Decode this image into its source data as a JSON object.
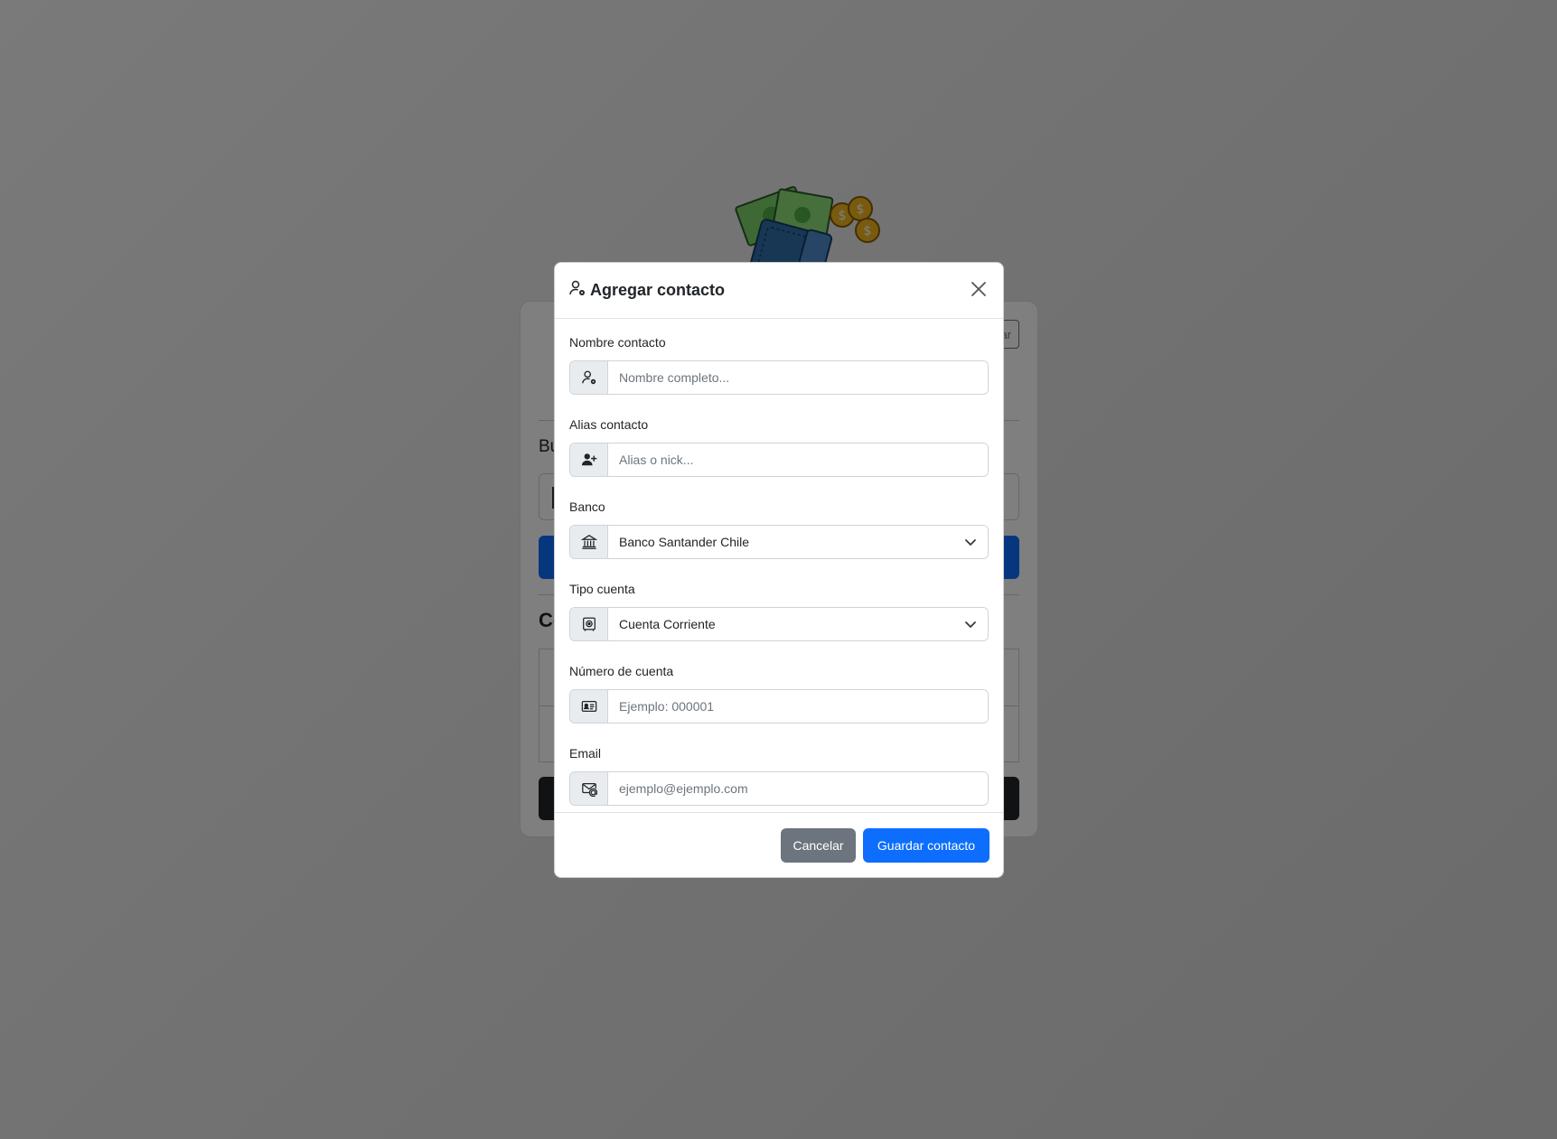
{
  "background": {
    "small_button_label": "ar",
    "search_label_partial": "Bu",
    "section_title_partial": "Co"
  },
  "modal": {
    "title": "Agregar contacto",
    "fields": {
      "nombre": {
        "label": "Nombre contacto",
        "placeholder": "Nombre completo...",
        "value": ""
      },
      "alias": {
        "label": "Alias contacto",
        "placeholder": "Alias o nick...",
        "value": ""
      },
      "banco": {
        "label": "Banco",
        "selected": "Banco Santander Chile"
      },
      "tipo": {
        "label": "Tipo cuenta",
        "selected": "Cuenta Corriente"
      },
      "numero": {
        "label": "Número de cuenta",
        "placeholder": "Ejemplo: 000001",
        "value": ""
      },
      "email": {
        "label": "Email",
        "placeholder": "ejemplo@ejemplo.com",
        "value": ""
      }
    },
    "buttons": {
      "cancel": "Cancelar",
      "save": "Guardar contacto"
    }
  },
  "icons": {
    "title": "person-gear-icon",
    "nombre": "person-gear-icon",
    "alias": "person-plus-icon",
    "banco": "bank-icon",
    "tipo": "safe-icon",
    "numero": "id-card-icon",
    "email": "envelope-at-icon",
    "close": "close-icon",
    "select_arrow": "chevron-down-icon"
  },
  "colors": {
    "primary": "#0d6efd",
    "secondary": "#6c757d",
    "overlay": "rgba(0,0,0,0.5)",
    "bill_green": "#7cd36b",
    "wallet_blue": "#2f6fa8",
    "coin_gold": "#f2b720"
  }
}
